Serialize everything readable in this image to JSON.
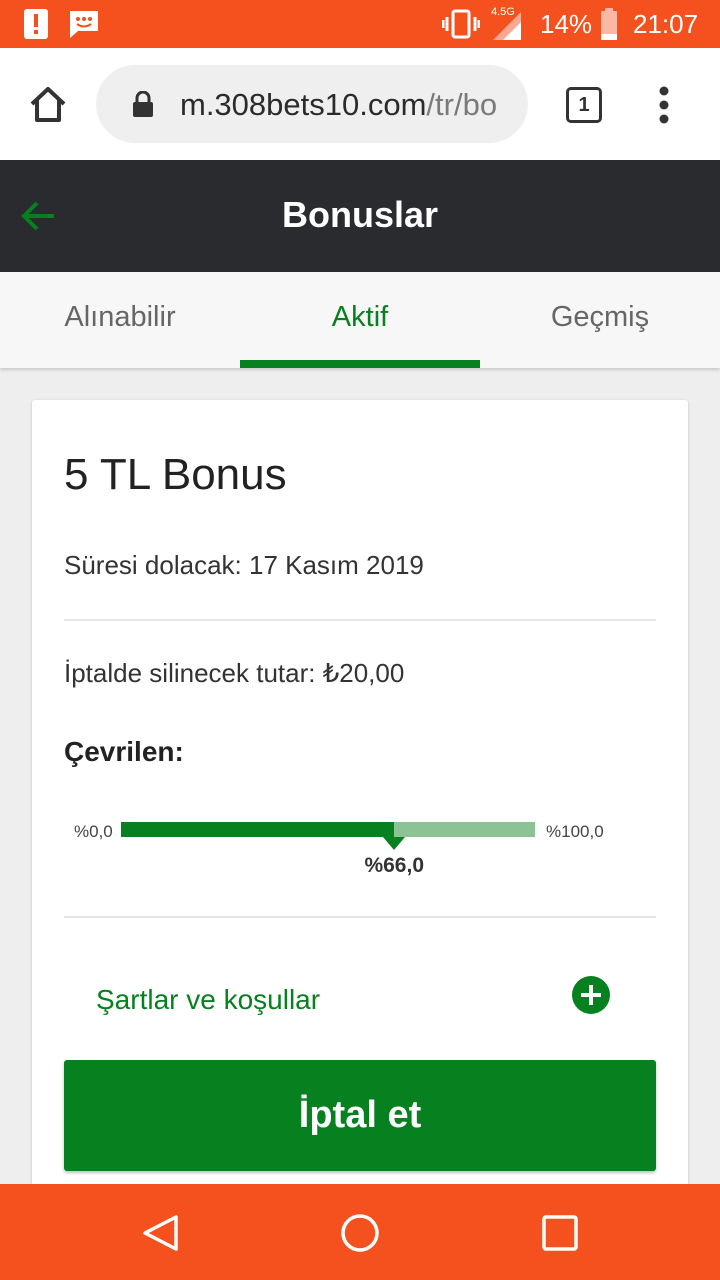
{
  "status_bar": {
    "network": "4.5G",
    "battery": "14%",
    "time": "21:07",
    "icons": [
      "alert-icon",
      "sms-icon",
      "vibrate-icon",
      "signal-icon",
      "battery-icon"
    ]
  },
  "browser": {
    "url_host": "m.308bets10.com",
    "url_path": "/tr/bo",
    "tab_count": "1"
  },
  "header": {
    "title": "Bonuslar"
  },
  "tabs": [
    {
      "label": "Alınabilir",
      "active": false
    },
    {
      "label": "Aktif",
      "active": true
    },
    {
      "label": "Geçmiş",
      "active": false
    }
  ],
  "bonus": {
    "title": "5 TL Bonus",
    "expiry": "Süresi dolacak: 17 Kasım 2019",
    "cancel_amount": "İptalde silinecek tutar: ₺20,00",
    "rolled_label": "Çevrilen:",
    "progress_min": "%0,0",
    "progress_max": "%100,0",
    "progress_value_label": "%66,0",
    "progress_fraction": 0.66,
    "terms_label": "Şartlar ve koşullar",
    "cancel_button": "İptal et"
  },
  "colors": {
    "status_bar": "#f4511e",
    "header": "#2a2b2e",
    "accent": "#07801f",
    "progress_track": "#8cc394"
  }
}
